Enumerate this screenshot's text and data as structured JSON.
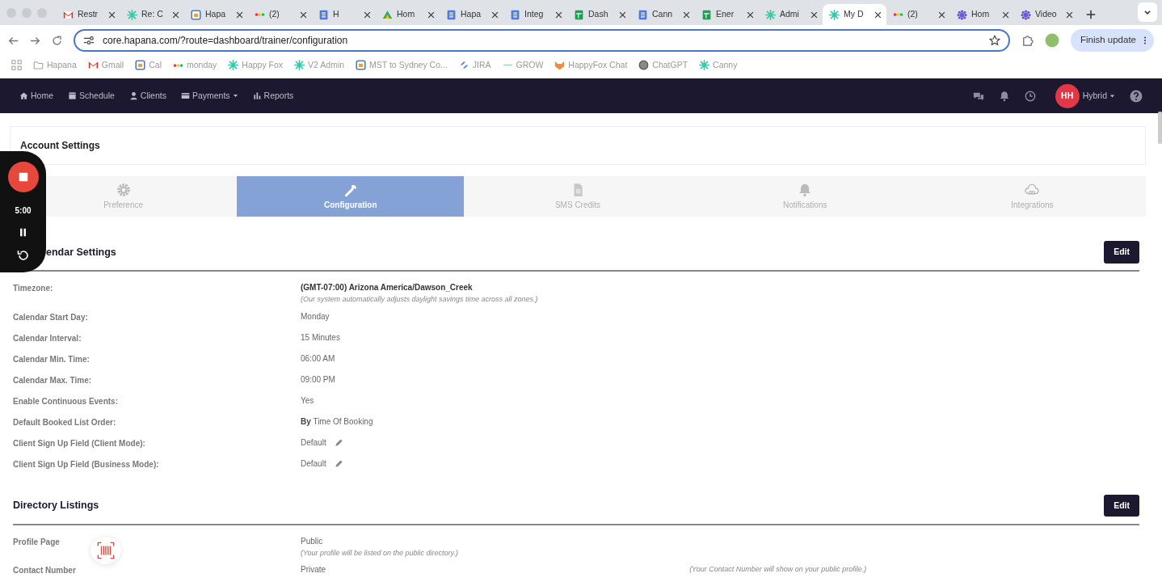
{
  "browser": {
    "tabs": [
      {
        "title": "Restr",
        "selected": false
      },
      {
        "title": "Re: C",
        "selected": false
      },
      {
        "title": "Hapa",
        "selected": false
      },
      {
        "title": "(2)",
        "selected": false
      },
      {
        "title": "H",
        "selected": false
      },
      {
        "title": "Hom",
        "selected": false
      },
      {
        "title": "Hapa",
        "selected": false
      },
      {
        "title": "Integ",
        "selected": false
      },
      {
        "title": "Dash",
        "selected": false
      },
      {
        "title": "Cann",
        "selected": false
      },
      {
        "title": "Ener",
        "selected": false
      },
      {
        "title": "Admi",
        "selected": false
      },
      {
        "title": "My D",
        "selected": true
      },
      {
        "title": "(2)",
        "selected": false
      },
      {
        "title": "Hom",
        "selected": false
      },
      {
        "title": "Video",
        "selected": false
      }
    ],
    "url": "core.hapana.com/?route=dashboard/trainer/configuration",
    "update_button": "Finish update",
    "bookmarks": [
      "Hapana",
      "Gmail",
      "Cal",
      "monday",
      "Happy Fox",
      "V2 Admin",
      "MST to Sydney Co...",
      "JIRA",
      "GROW",
      "HappyFox Chat",
      "ChatGPT",
      "Canny"
    ]
  },
  "nav": {
    "items": [
      {
        "label": "Home",
        "dropdown": false
      },
      {
        "label": "Schedule",
        "dropdown": false
      },
      {
        "label": "Clients",
        "dropdown": false
      },
      {
        "label": "Payments",
        "dropdown": true
      },
      {
        "label": "Reports",
        "dropdown": false
      }
    ],
    "avatar_initials": "HH",
    "account": "Hybrid"
  },
  "page_title": "Account Settings",
  "settings_tabs": [
    {
      "label": "Preference",
      "selected": false
    },
    {
      "label": "Configuration",
      "selected": true
    },
    {
      "label": "SMS Credits",
      "selected": false
    },
    {
      "label": "Notifications",
      "selected": false
    },
    {
      "label": "Integrations",
      "selected": false
    }
  ],
  "recorder": {
    "time": "5:00"
  },
  "sections": [
    {
      "title": "endar Settings",
      "button": "Edit",
      "rows": [
        {
          "kind": "stacked",
          "label": "Timezone:",
          "value": "(GMT-07:00) Arizona America/Dawson_Creek",
          "value_bold": true,
          "note": "(Our system automatically adjusts daylight savings time across all zones.)",
          "editable": false
        },
        {
          "label": "Calendar Start Day:",
          "value": "Monday",
          "value_bold": false,
          "editable": false
        },
        {
          "label": "Calendar Interval:",
          "value": "15 Minutes",
          "value_bold": false,
          "editable": false
        },
        {
          "label": "Calendar Min. Time:",
          "value": "06:00 AM",
          "value_bold": false,
          "editable": false
        },
        {
          "label": "Calendar Max. Time:",
          "value": "09:00 PM",
          "value_bold": false,
          "editable": false
        },
        {
          "label": "Enable Continuous Events:",
          "value": "Yes",
          "value_bold": false,
          "editable": false
        },
        {
          "label": "Default Booked List Order:",
          "value": "**By** Time Of Booking",
          "value_bold": false,
          "editable": false
        },
        {
          "label": "Client Sign Up Field (Client Mode):",
          "value": "Default",
          "value_bold": false,
          "editable": true
        },
        {
          "label": "Client Sign Up Field (Business Mode):",
          "value": "Default",
          "value_bold": false,
          "editable": true
        }
      ]
    },
    {
      "title": "Directory Listings",
      "button": "Edit",
      "rows": [
        {
          "kind": "stacked",
          "label": "Profile Page",
          "value": "Public",
          "value_bold": false,
          "note": "(Your profile will be listed on the public directory.)",
          "editable": false
        },
        {
          "kind": "inline",
          "label": "Contact Number",
          "value": "Private",
          "value_bold": false,
          "note": "(Your Contact Number will show on your public profile.)",
          "editable": false
        }
      ]
    }
  ]
}
